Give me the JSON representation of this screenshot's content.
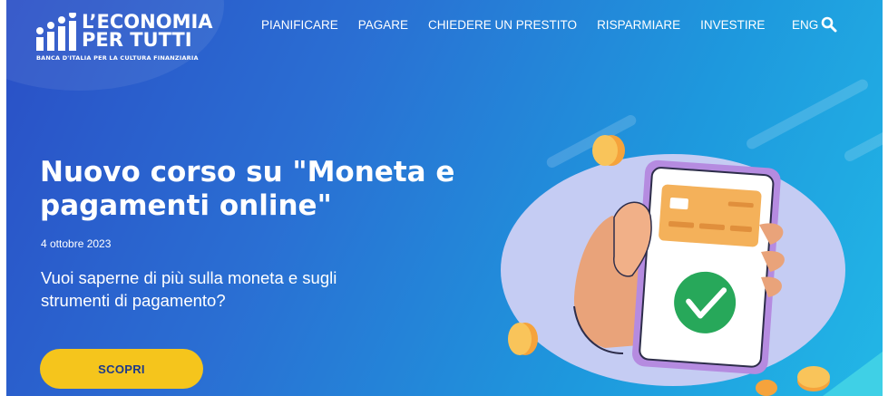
{
  "brand": {
    "line1": "L’ECONOMIA",
    "line2": "PER TUTTI",
    "subtitle": "BANCA D'ITALIA PER LA CULTURA FINANZIARIA"
  },
  "nav": {
    "items": [
      {
        "label": "PIANIFICARE"
      },
      {
        "label": "PAGARE"
      },
      {
        "label": "CHIEDERE UN PRESTITO"
      },
      {
        "label": "RISPARMIARE"
      },
      {
        "label": "INVESTIRE"
      }
    ],
    "language": "ENG",
    "search_icon": "search-icon"
  },
  "hero": {
    "title": "Nuovo corso su \"Moneta e pagamenti online\"",
    "date": "4 ottobre 2023",
    "lead": "Vuoi saperne di più sulla moneta e sugli strumenti di pagamento?",
    "cta_label": "SCOPRI"
  },
  "colors": {
    "accent": "#f5c51c",
    "button_text": "#1e3a8a",
    "hero_start": "#2a4fc6",
    "hero_end": "#22b7e6"
  }
}
